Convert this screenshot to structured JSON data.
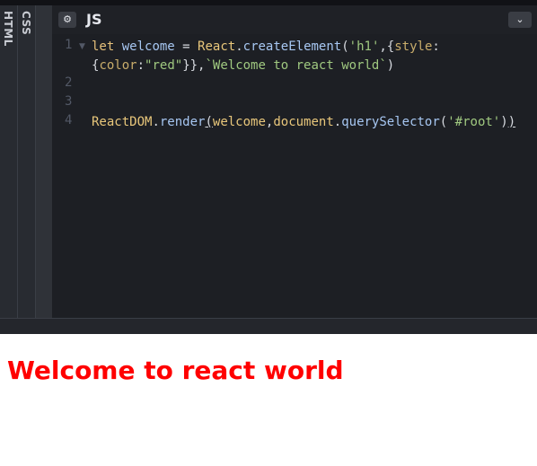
{
  "side_tabs": {
    "html_label": "HTML",
    "css_label": "CSS"
  },
  "js_panel": {
    "title": "JS",
    "settings_icon": "gear-icon",
    "collapse_icon": "chevron-down-icon",
    "line_numbers": [
      "1",
      "2",
      "3",
      "4"
    ],
    "code": {
      "line1": {
        "let": "let",
        "welcome": "welcome",
        "eq": " = ",
        "react": "React",
        "dot1": ".",
        "createElement": "createElement",
        "p1": "(",
        "h1": "'h1'",
        "p2": ",{",
        "style": "style",
        "colon": ":"
      },
      "line1b": {
        "open": "{",
        "color": "color",
        "colon": ":",
        "red": "\"red\"",
        "close": "}},",
        "tmpl": "`Welcome to react world`",
        "end": ")"
      },
      "line4": {
        "reactdom": "ReactDOM",
        "dot1": ".",
        "render": "render",
        "p1": "(",
        "welcome": "welcome",
        "comma": ",",
        "document": "document",
        "dot2": ".",
        "qs": "querySelector",
        "p2": "(",
        "root": "'#root'",
        "p3": ")",
        "p4": ")"
      }
    }
  },
  "preview": {
    "heading": "Welcome to react world",
    "heading_color": "#ff0000"
  }
}
